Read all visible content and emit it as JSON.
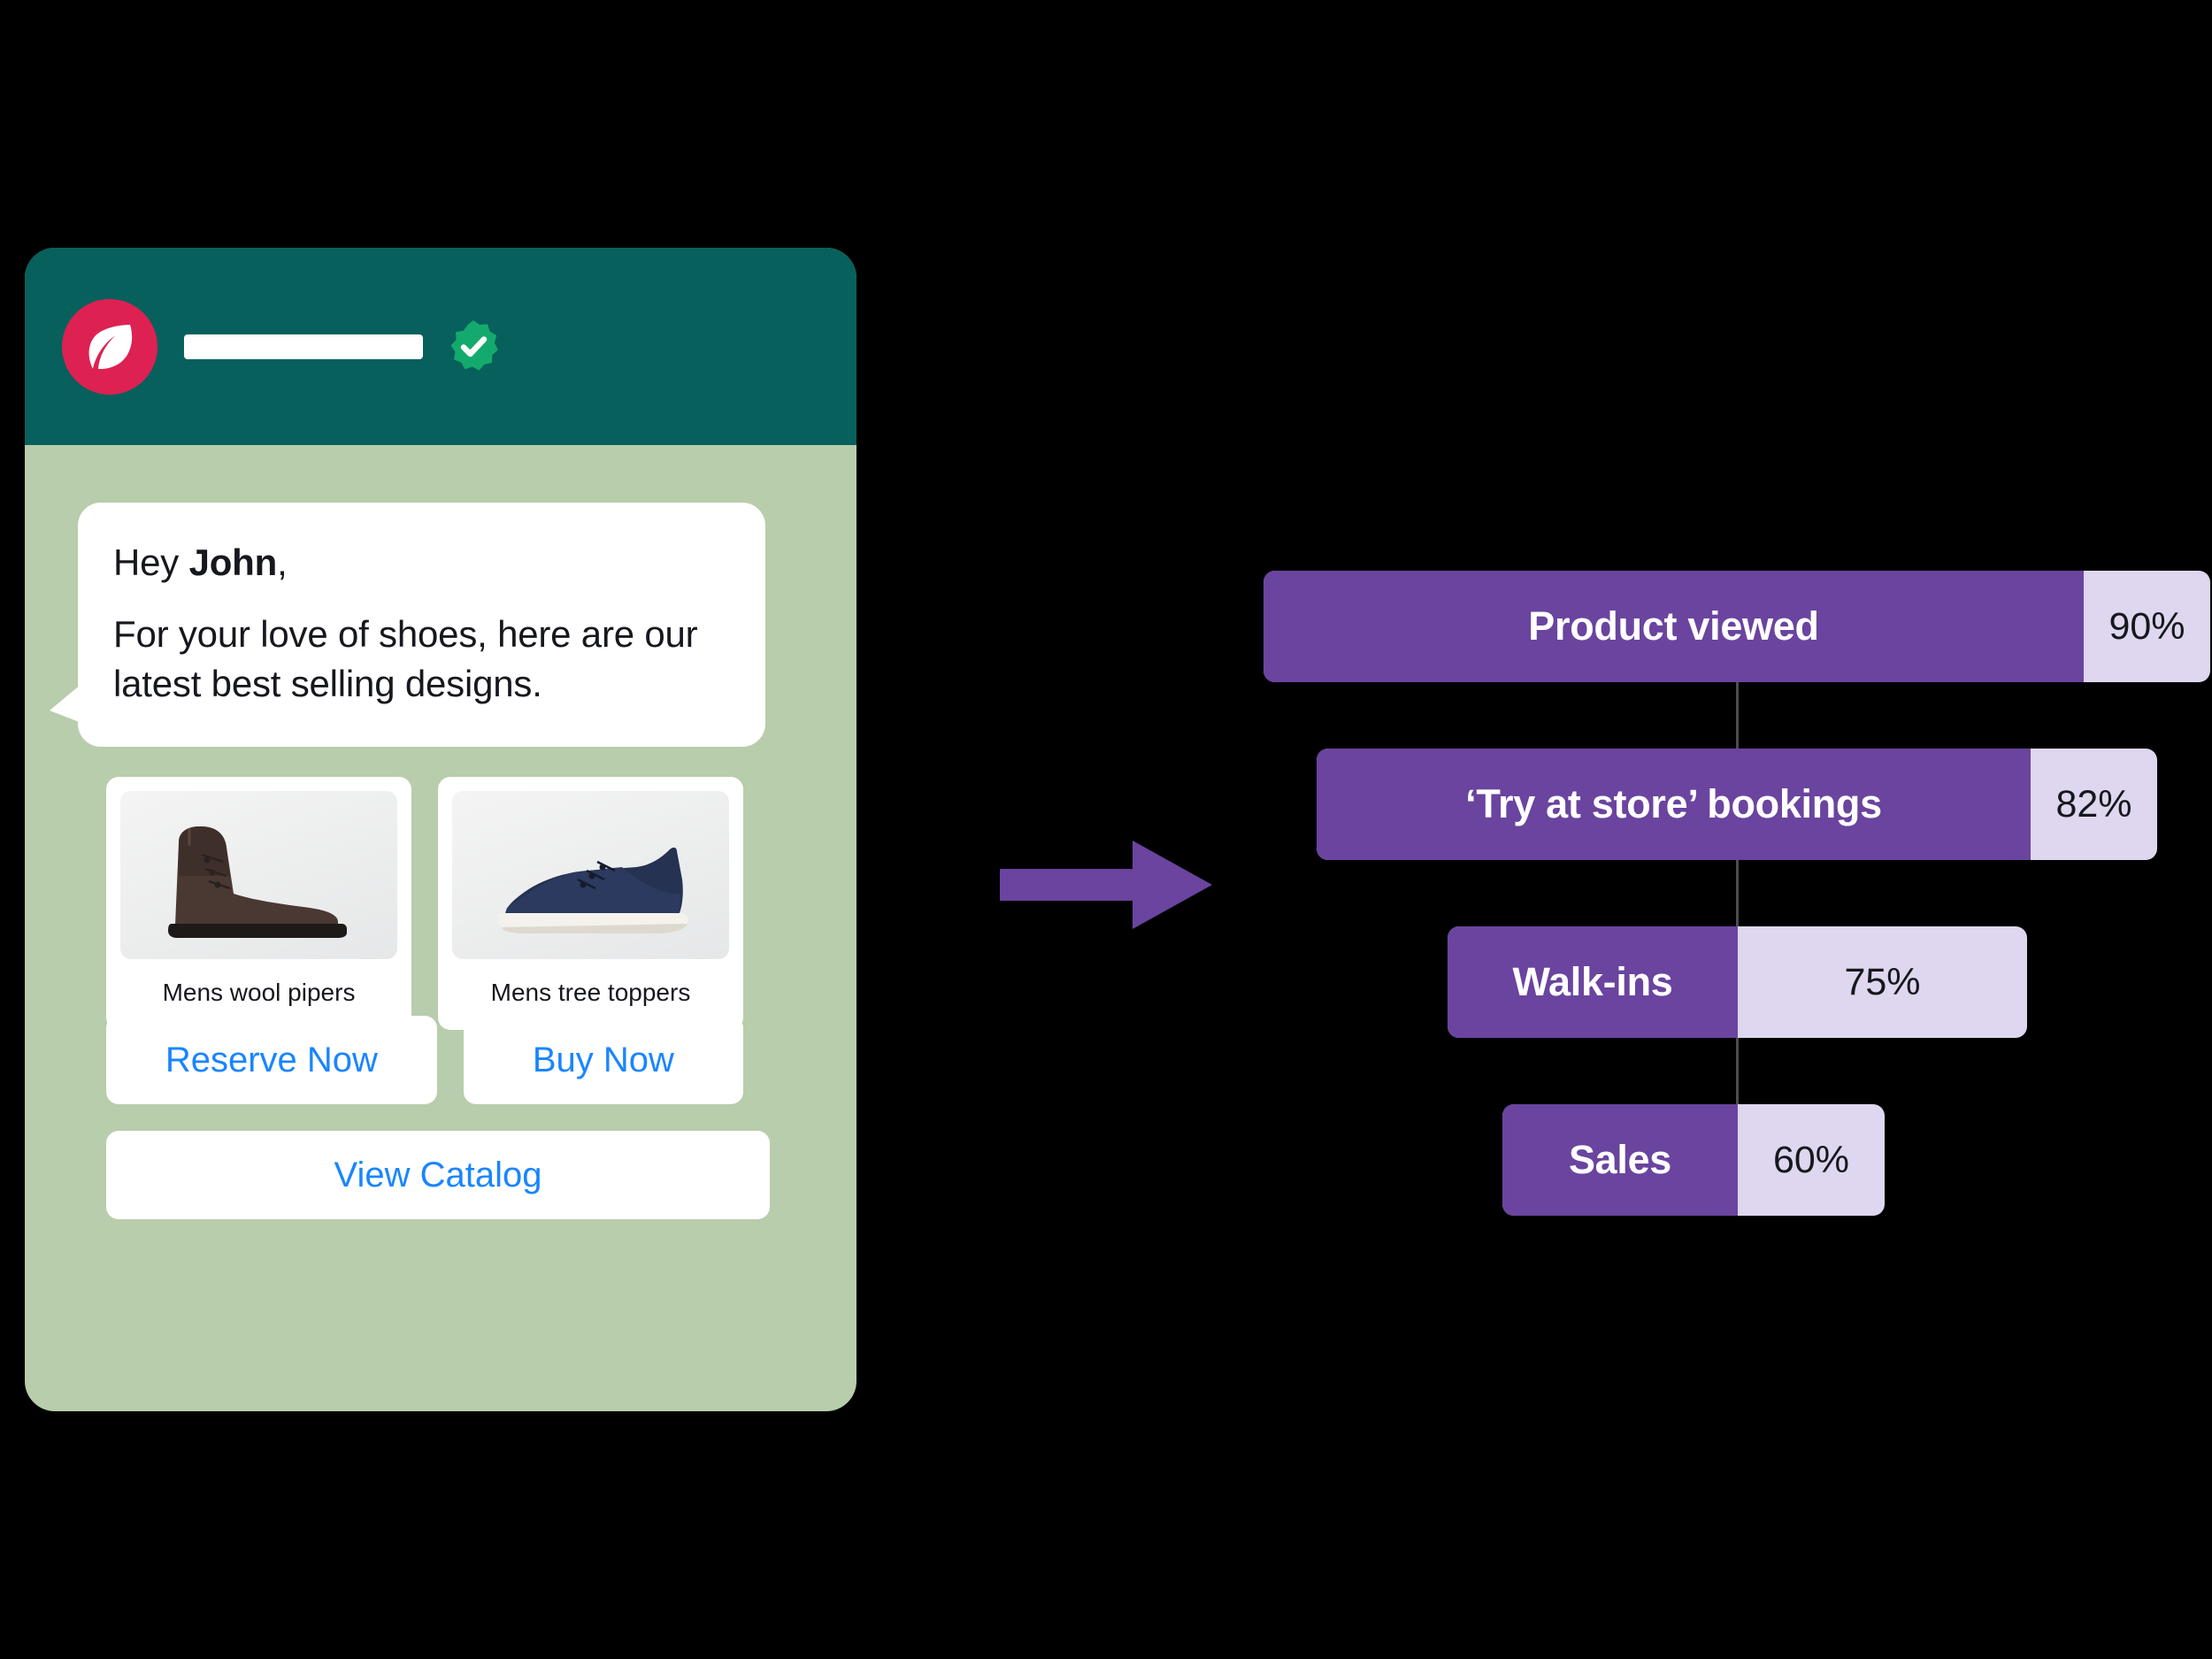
{
  "chat": {
    "header": {
      "brand_logo_icon": "leaf-icon",
      "business_name_redacted": "",
      "verified_icon": "verified-badge-icon"
    },
    "message": {
      "greeting_prefix": "Hey ",
      "greeting_name": "John",
      "greeting_suffix": ",",
      "body": "For your love of shoes, here are our latest best selling designs."
    },
    "products": [
      {
        "name": "Mens wool pipers",
        "image_icon": "brown-high-top-sneaker-image"
      },
      {
        "name": "Mens tree toppers",
        "image_icon": "navy-low-top-sneaker-image"
      }
    ],
    "buttons": {
      "reserve": "Reserve Now",
      "buy": "Buy Now",
      "catalog": "View Catalog"
    }
  },
  "arrow": {
    "icon": "right-arrow-icon",
    "color": "#6a449f"
  },
  "chart_data": {
    "type": "bar",
    "title": "",
    "xlabel": "",
    "ylabel": "",
    "orientation": "horizontal",
    "layout": "centered-funnel",
    "grid": false,
    "legend": null,
    "categories": [
      "Product viewed",
      "'Try at store' bookings",
      "Walk-ins",
      "Sales"
    ],
    "values": [
      90,
      82,
      75,
      60
    ],
    "value_labels": [
      "90%",
      "82%",
      "75%",
      "60%"
    ],
    "xlim": [
      0,
      100
    ],
    "colors": {
      "fill": "#6a449f",
      "track": "#ded7ef",
      "connector": "#4c4c52",
      "label": "#ffffff",
      "value": "#16181d"
    },
    "stages": [
      {
        "label": "Product viewed",
        "value": 90,
        "value_label": "90%"
      },
      {
        "label": "‘Try at store’ bookings",
        "value": 82,
        "value_label": "82%"
      },
      {
        "label": "Walk-ins",
        "value": 75,
        "value_label": "75%"
      },
      {
        "label": "Sales",
        "value": 60,
        "value_label": "60%"
      }
    ]
  },
  "colors": {
    "chat_header": "#07605c",
    "chat_body": "#b8cdab",
    "brand_accent": "#dd2152",
    "verified": "#14aa6d",
    "link": "#1a85ff",
    "purple": "#6a449f",
    "lavender": "#ded7ef"
  }
}
